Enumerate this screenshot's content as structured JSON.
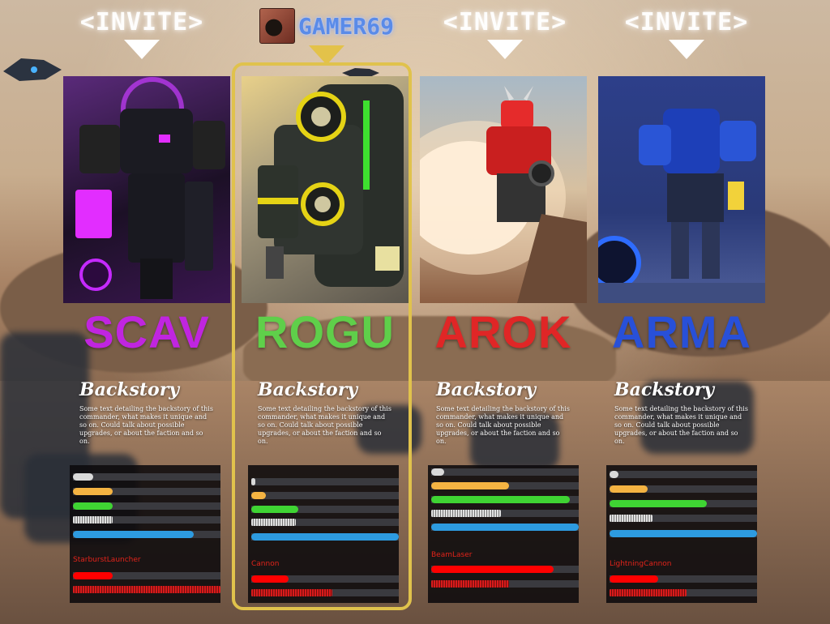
{
  "header": {
    "slot_1": {
      "invite_label": "<INVITE>"
    },
    "slot_2": {
      "player_name": "GAMER69"
    },
    "slot_3": {
      "invite_label": "<INVITE>"
    },
    "slot_4": {
      "invite_label": "<INVITE>"
    }
  },
  "commanders": [
    {
      "name": "SCAV",
      "name_color": "#c025e0",
      "backstory_title": "Backstory",
      "backstory_text": "Some text detailing the backstory of this commander, what makes it unique and so on. Could talk about possible upgrades, or about the faction and so on.",
      "weapon": "StarburstLauncher",
      "stats": [
        0.14,
        0.27,
        0.27,
        0.27,
        0.82
      ],
      "weapon_stats": [
        0.27,
        1.0
      ]
    },
    {
      "name": "ROGU",
      "name_color": "#5fcf4a",
      "backstory_title": "Backstory",
      "backstory_text": "Some text detailing the backstory of this commander, what makes it unique and so on. Could talk about possible upgrades, or about the faction and so on.",
      "weapon": "Cannon",
      "stats": [
        0.03,
        0.1,
        0.32,
        0.3,
        1.0
      ],
      "weapon_stats": [
        0.25,
        0.55
      ]
    },
    {
      "name": "AROK",
      "name_color": "#e02626",
      "backstory_title": "Backstory",
      "backstory_text": "Some text detailing the backstory of this commander, what makes it unique and so on. Could talk about possible upgrades, or about the faction and so on.",
      "weapon": "BeamLaser",
      "stats": [
        0.09,
        0.53,
        0.94,
        0.47,
        1.0
      ],
      "weapon_stats": [
        0.83,
        0.53
      ]
    },
    {
      "name": "ARMA",
      "name_color": "#2850d8",
      "backstory_title": "Backstory",
      "backstory_text": "Some text detailing the backstory of this commander, what makes it unique and so on. Could talk about possible upgrades, or about the faction and so on.",
      "weapon": "LightningCannon",
      "stats": [
        0.06,
        0.26,
        0.66,
        0.29,
        1.0
      ],
      "weapon_stats": [
        0.33,
        0.52
      ]
    }
  ],
  "colors": {
    "stat_bars": [
      "#d9d9d9",
      "#f4b342",
      "#3fd433",
      "#cfcfcf",
      "#2d9be0"
    ],
    "weapon_primary": "#ff0000",
    "selected_frame": "#e0c24c"
  },
  "icons": {
    "portrait_scav": "purple-mech",
    "portrait_rogu": "green-yellow-mech",
    "portrait_arok": "red-horned-mech",
    "portrait_arma": "blue-mech"
  }
}
